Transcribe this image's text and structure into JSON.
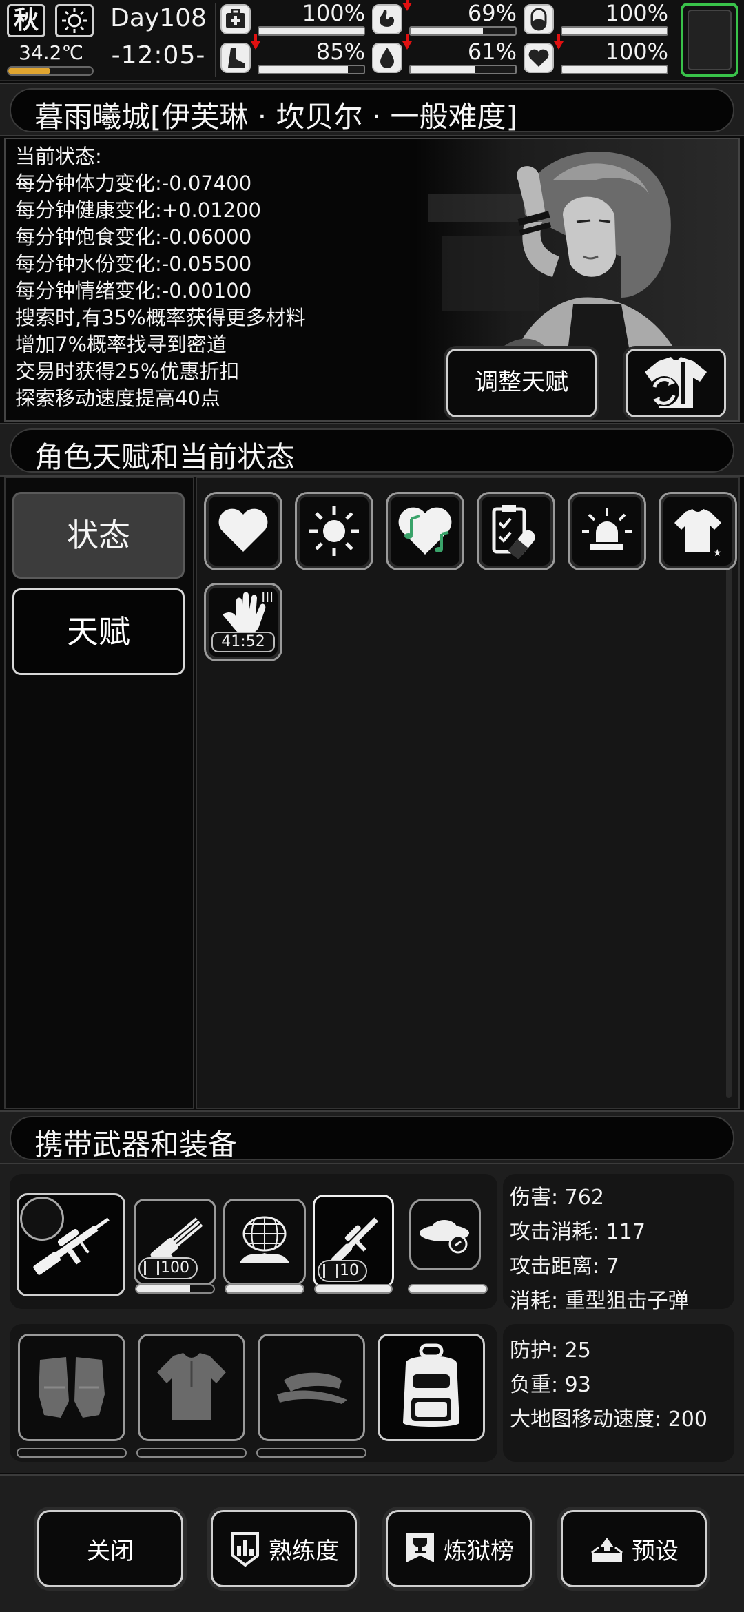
{
  "hud": {
    "season": "秋",
    "weather_icon": "sun-icon",
    "temperature": "34.2℃",
    "temperature_level": 0.5,
    "day": "Day108",
    "time": "-12:05-",
    "stats": [
      {
        "name": "health",
        "icon": "medkit-icon",
        "value": "100%",
        "level": 1.0,
        "decreasing": false
      },
      {
        "name": "hunger",
        "icon": "stomach-icon",
        "value": "69%",
        "level": 0.69,
        "decreasing": true
      },
      {
        "name": "stamina",
        "icon": "pill-icon",
        "value": "100%",
        "level": 1.0,
        "decreasing": false
      },
      {
        "name": "leg",
        "icon": "boot-icon",
        "value": "85%",
        "level": 0.85,
        "decreasing": true
      },
      {
        "name": "water",
        "icon": "water-drop-icon",
        "value": "61%",
        "level": 0.61,
        "decreasing": true
      },
      {
        "name": "mood",
        "icon": "heart-icon",
        "value": "100%",
        "level": 1.0,
        "decreasing": true
      }
    ],
    "slot_color": "#39c24a"
  },
  "character": {
    "header": "暮雨曦城[伊芙琳 · 坎贝尔 · 一般难度]",
    "status_lines": [
      "当前状态:",
      "每分钟体力变化:-0.07400",
      "每分钟健康变化:+0.01200",
      "每分钟饱食变化:-0.06000",
      "每分钟水份变化:-0.05500",
      "每分钟情绪变化:-0.00100",
      "搜索时,有35%概率获得更多材料",
      "增加7%概率找寻到密道",
      "交易时获得25%优惠折扣",
      "探索移动速度提高40点"
    ],
    "adjust_talent_button": "调整天赋",
    "outfit_button_icon": "outfit-swap-icon"
  },
  "talents": {
    "header": "角色天赋和当前状态",
    "tabs": [
      "状态",
      "天赋"
    ],
    "active_tab": "状态",
    "buffs": [
      {
        "icon": "heart-icon"
      },
      {
        "icon": "sun-icon"
      },
      {
        "icon": "music-heart-icon"
      },
      {
        "icon": "medical-clipboard-icon"
      },
      {
        "icon": "alarm-light-icon"
      },
      {
        "icon": "shirt-icon"
      },
      {
        "icon": "hand-icon",
        "tier": "III",
        "timer": "41:52"
      }
    ]
  },
  "equipment": {
    "header": "携带武器和装备",
    "weapons": [
      {
        "icon": "sniper-rifle-icon",
        "durability": 1.0
      },
      {
        "icon": "minigun-icon",
        "ammo": "100",
        "durability": 0.7
      },
      {
        "icon": "net-trap-icon",
        "durability": 1.0
      },
      {
        "icon": "spear-gun-icon",
        "ammo": "10",
        "durability": 1.0
      },
      {
        "icon": "ufo-disc-icon",
        "durability": 1.0
      }
    ],
    "weapon_stats": [
      "伤害: 762",
      "攻击消耗: 117",
      "攻击距离: 7",
      "消耗: 重型狙击子弹"
    ],
    "gear": [
      {
        "icon": "gloves-icon"
      },
      {
        "icon": "shirt-icon"
      },
      {
        "icon": "visor-cap-icon"
      },
      {
        "icon": "backpack-icon"
      }
    ],
    "gear_stats": [
      "防护: 25",
      "负重: 93",
      "大地图移动速度: 200"
    ]
  },
  "footer": {
    "close": "关闭",
    "proficiency": "熟练度",
    "leaderboard": "炼狱榜",
    "preset": "预设"
  }
}
